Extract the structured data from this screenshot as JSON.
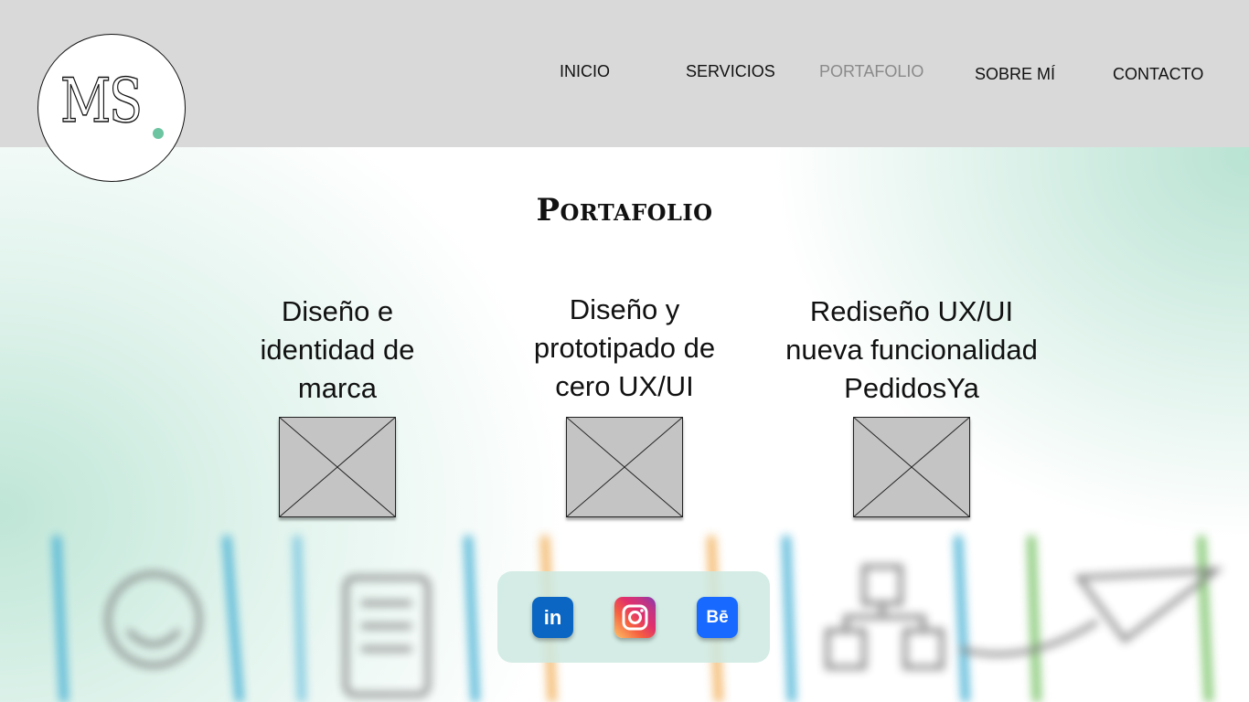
{
  "logo": {
    "text": "MS",
    "accent_color": "#6cc4a1"
  },
  "nav": {
    "items": [
      {
        "label": "INICIO",
        "active": false
      },
      {
        "label": "SERVICIOS",
        "active": false
      },
      {
        "label": "PORTAFOLIO",
        "active": true
      },
      {
        "label": "SOBRE MÍ",
        "active": false
      },
      {
        "label": "CONTACTO",
        "active": false
      }
    ]
  },
  "main": {
    "title": "Portafolio",
    "projects": [
      {
        "title_lines": [
          "Diseño e",
          "identidad de",
          "marca"
        ]
      },
      {
        "title_lines": [
          "Diseño y",
          "prototipado de",
          "cero UX/UI"
        ]
      },
      {
        "title_lines": [
          "Rediseño UX/UI",
          "nueva funcionalidad",
          "PedidosYa"
        ]
      }
    ]
  },
  "social": {
    "linkedin_label": "in",
    "instagram_icon": "instagram-icon",
    "behance_label": "Bē"
  },
  "colors": {
    "header_bg": "#d9d9d9",
    "mint": "#bfe6d7",
    "placeholder": "#c4c4c4"
  }
}
